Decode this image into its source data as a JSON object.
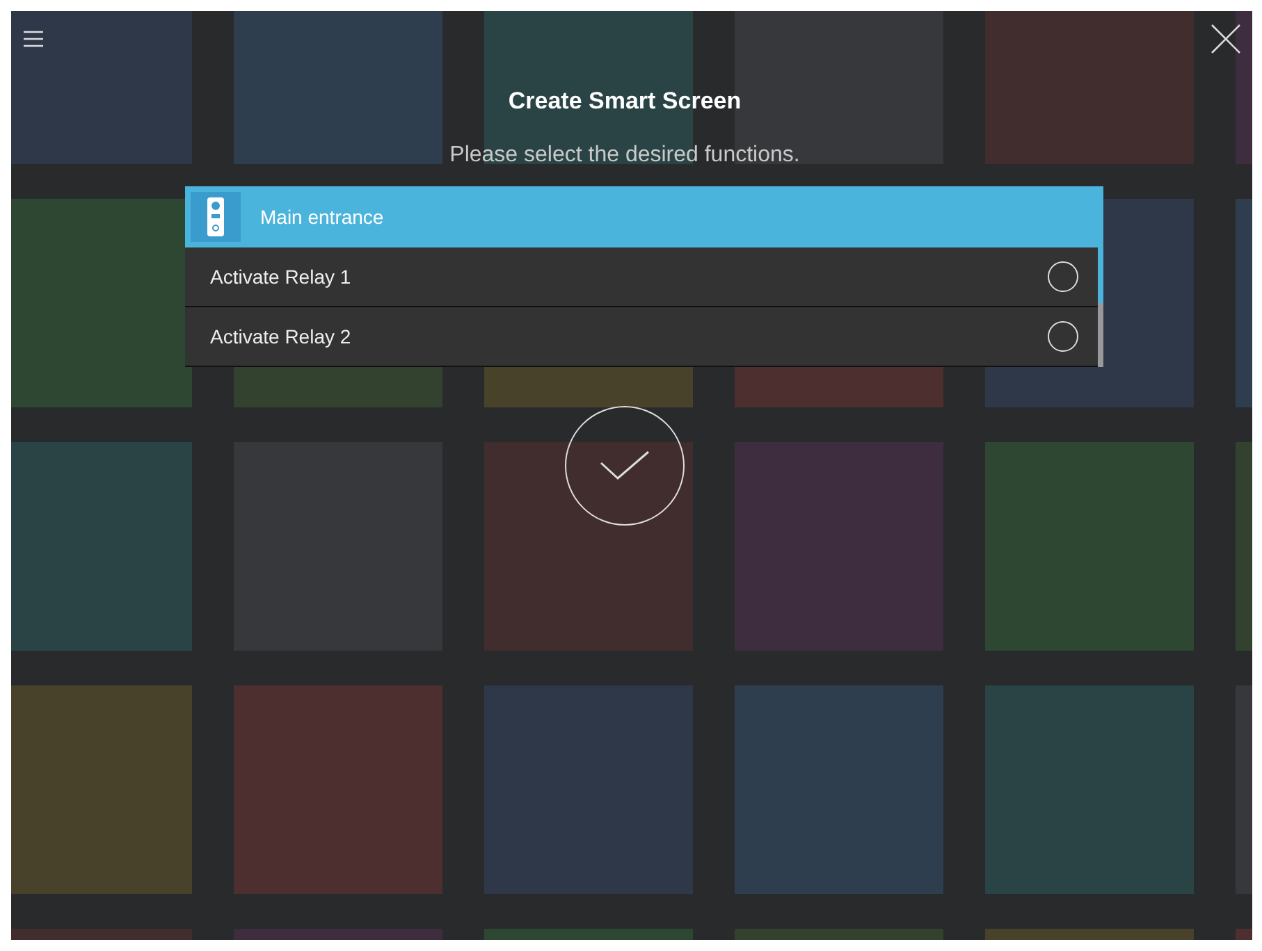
{
  "title": "Create Smart Screen",
  "subtitle": "Please select the desired functions.",
  "group": {
    "label": "Main entrance"
  },
  "functions": [
    {
      "label": "Activate Relay 1",
      "selected": false
    },
    {
      "label": "Activate Relay 2",
      "selected": false
    }
  ]
}
